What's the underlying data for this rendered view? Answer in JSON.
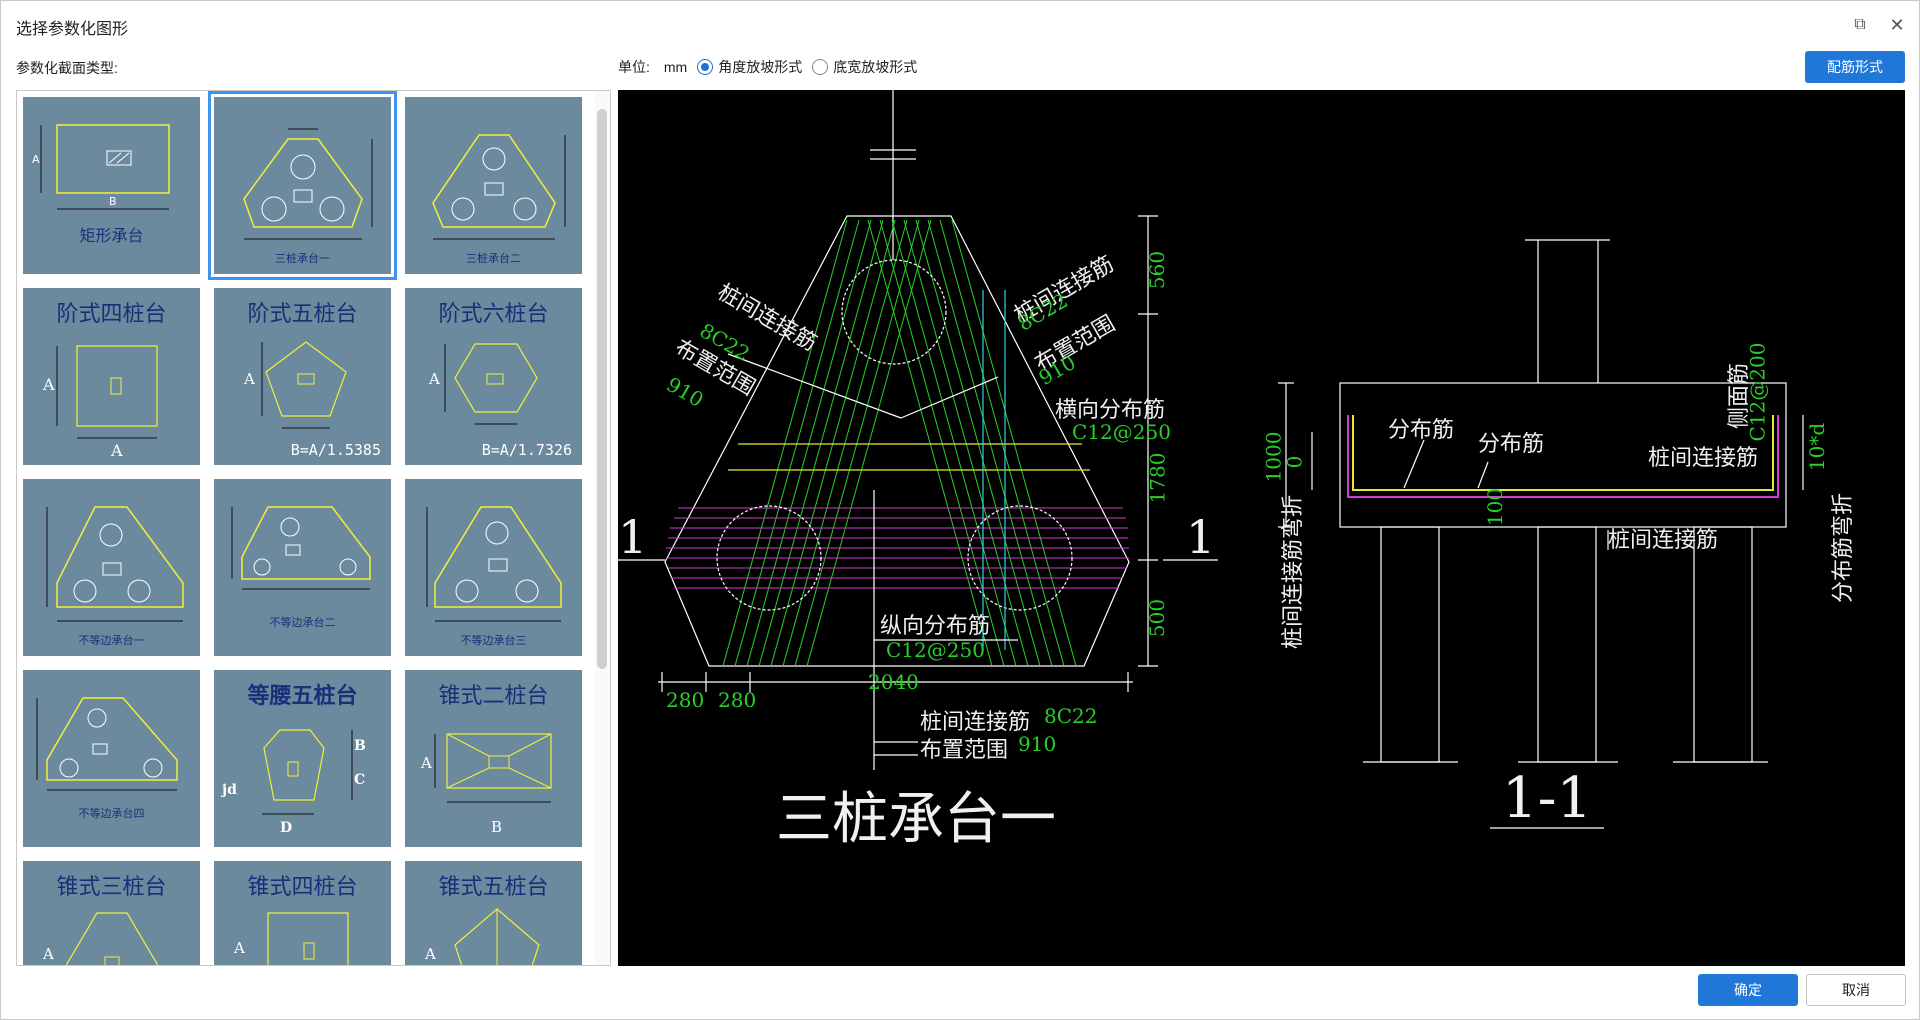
{
  "window": {
    "title": "选择参数化图形",
    "restore_icon": "restore-icon",
    "close_icon": "close-icon"
  },
  "gallery": {
    "label": "参数化截面类型:",
    "items": [
      {
        "id": "rect",
        "label": "矩形承台"
      },
      {
        "id": "tri1",
        "label": "三桩承台一"
      },
      {
        "id": "tri2",
        "label": "三桩承台二"
      },
      {
        "id": "step4",
        "label": "阶式四桩台"
      },
      {
        "id": "step5",
        "label": "阶式五桩台",
        "note": "B=A/1.5385"
      },
      {
        "id": "step6",
        "label": "阶式六桩台",
        "note": "B=A/1.7326"
      },
      {
        "id": "uneq1",
        "label": "不等边承台一"
      },
      {
        "id": "uneq2",
        "label": "不等边承台二"
      },
      {
        "id": "uneq3",
        "label": "不等边承台三"
      },
      {
        "id": "uneq4",
        "label": "不等边承台四"
      },
      {
        "id": "iso5",
        "label": "等腰五桩台"
      },
      {
        "id": "cone2",
        "label": "锥式二桩台"
      },
      {
        "id": "cone3",
        "label": "锥式三桩台"
      },
      {
        "id": "cone4",
        "label": "锥式四桩台"
      },
      {
        "id": "cone5",
        "label": "锥式五桩台"
      }
    ],
    "selected": "三桩承台一"
  },
  "options": {
    "unit_label": "单位:",
    "unit_value": "mm",
    "radio_angle": "角度放坡形式",
    "radio_width": "底宽放坡形式",
    "selected_radio": "angle"
  },
  "buttons": {
    "rebar": "配筋形式",
    "ok": "确定",
    "cancel": "取消"
  },
  "preview": {
    "plan_title": "三桩承台一",
    "section_title": "1-1",
    "section_mark": "1",
    "labels": {
      "pile_link_left": "桩间连接筋",
      "pile_link_left_spec": "8C22",
      "range_left": "布置范围",
      "range_left_val": "910",
      "pile_link_right": "桩间连接筋",
      "pile_link_right_spec": "8C22",
      "range_right": "布置范围",
      "range_right_val": "910",
      "trans_dist": "横向分布筋",
      "trans_dist_spec": "C12@250",
      "long_dist": "纵向分布筋",
      "long_dist_spec": "C12@250",
      "bottom_link": "桩间连接筋",
      "bottom_link_spec": "8C22",
      "bottom_range": "布置范围",
      "bottom_range_val": "910",
      "dim_560": "560",
      "dim_1780": "1780",
      "dim_500": "500",
      "dim_280a": "280",
      "dim_280b": "280",
      "dim_2040": "2040",
      "sec_dist1": "分布筋",
      "sec_dist2": "分布筋",
      "sec_pile_link_top": "桩间连接筋",
      "sec_pile_link_bottom": "桩间连接筋",
      "side_bar": "侧面筋",
      "side_bar_spec": "C12@200",
      "ten_d": "10*d",
      "dim_1000": "1000",
      "dim_0": "0",
      "dim_100": "100",
      "left_bend": "桩间连接筋弯折",
      "right_bend": "分布筋弯折"
    }
  }
}
